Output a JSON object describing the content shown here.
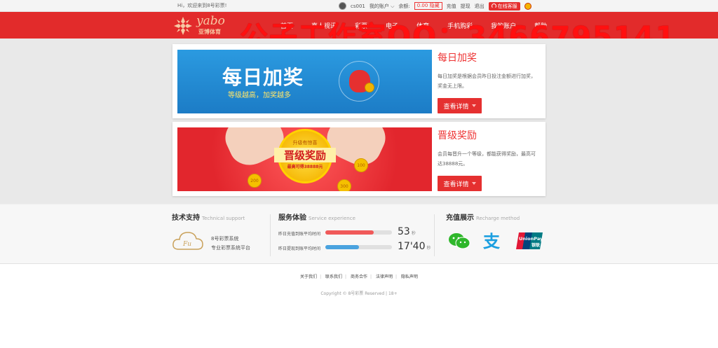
{
  "topbar": {
    "welcome": "Hi，欢迎来到8号彩票!",
    "username": "cs001",
    "my_account": "我的账户 ⌵",
    "balance_label": "余额:",
    "balance_value": "0.00",
    "refresh": "隐藏",
    "recharge": "充值",
    "withdraw": "提现",
    "logout": "退出",
    "service": "在线客服"
  },
  "nav": {
    "brand": "yabo",
    "brand_cn": "亚博体育",
    "items": [
      "首页",
      "真人视讯",
      "彩票",
      "电子",
      "体育",
      "手机购彩",
      "我的账户",
      "帮助"
    ]
  },
  "watermark": "公子工作室QQ：3466795141",
  "promos": [
    {
      "banner_title": "每日加奖",
      "banner_sub": "等级越高，加奖越多",
      "title": "每日加奖",
      "desc": "每日加奖是根据会员昨日投注金额进行加奖，奖金无上限。",
      "button": "查看详情"
    },
    {
      "banner_top": "升级有惊喜",
      "banner_main": "晋级奖励",
      "banner_cap": "最高可得38888元",
      "chips": [
        "100",
        "200",
        "300"
      ],
      "title": "晋级奖励",
      "desc": "会员每晋升一个等级，都能获得奖励，最高可达38888元。",
      "button": "查看详情"
    }
  ],
  "features": {
    "tech": {
      "title": "技术支持",
      "title_en": "Technical support",
      "line1": "8号彩票系统",
      "line2": "专业彩票系统平台"
    },
    "service": {
      "title": "服务体验",
      "title_en": "Service experience",
      "rows": [
        {
          "label": "昨日充值到账平均时间",
          "value": "53",
          "unit": "秒",
          "progress": 0.73,
          "color": "#f05a5a"
        },
        {
          "label": "昨日提现到账平均时间",
          "value": "17'40",
          "unit": "秒",
          "progress": 0.5,
          "color": "#4aa3df"
        }
      ]
    },
    "recharge": {
      "title": "充值展示",
      "title_en": "Recharge method",
      "alipay_glyph": "支",
      "unionpay_en": "UnionPay",
      "unionpay_cn": "银联"
    }
  },
  "footer": {
    "links": [
      "关于我们",
      "联系我们",
      "商务合作",
      "法律声明",
      "隐私声明"
    ],
    "copyright": "Copyright © 8号彩票 Reserved | 18+"
  }
}
